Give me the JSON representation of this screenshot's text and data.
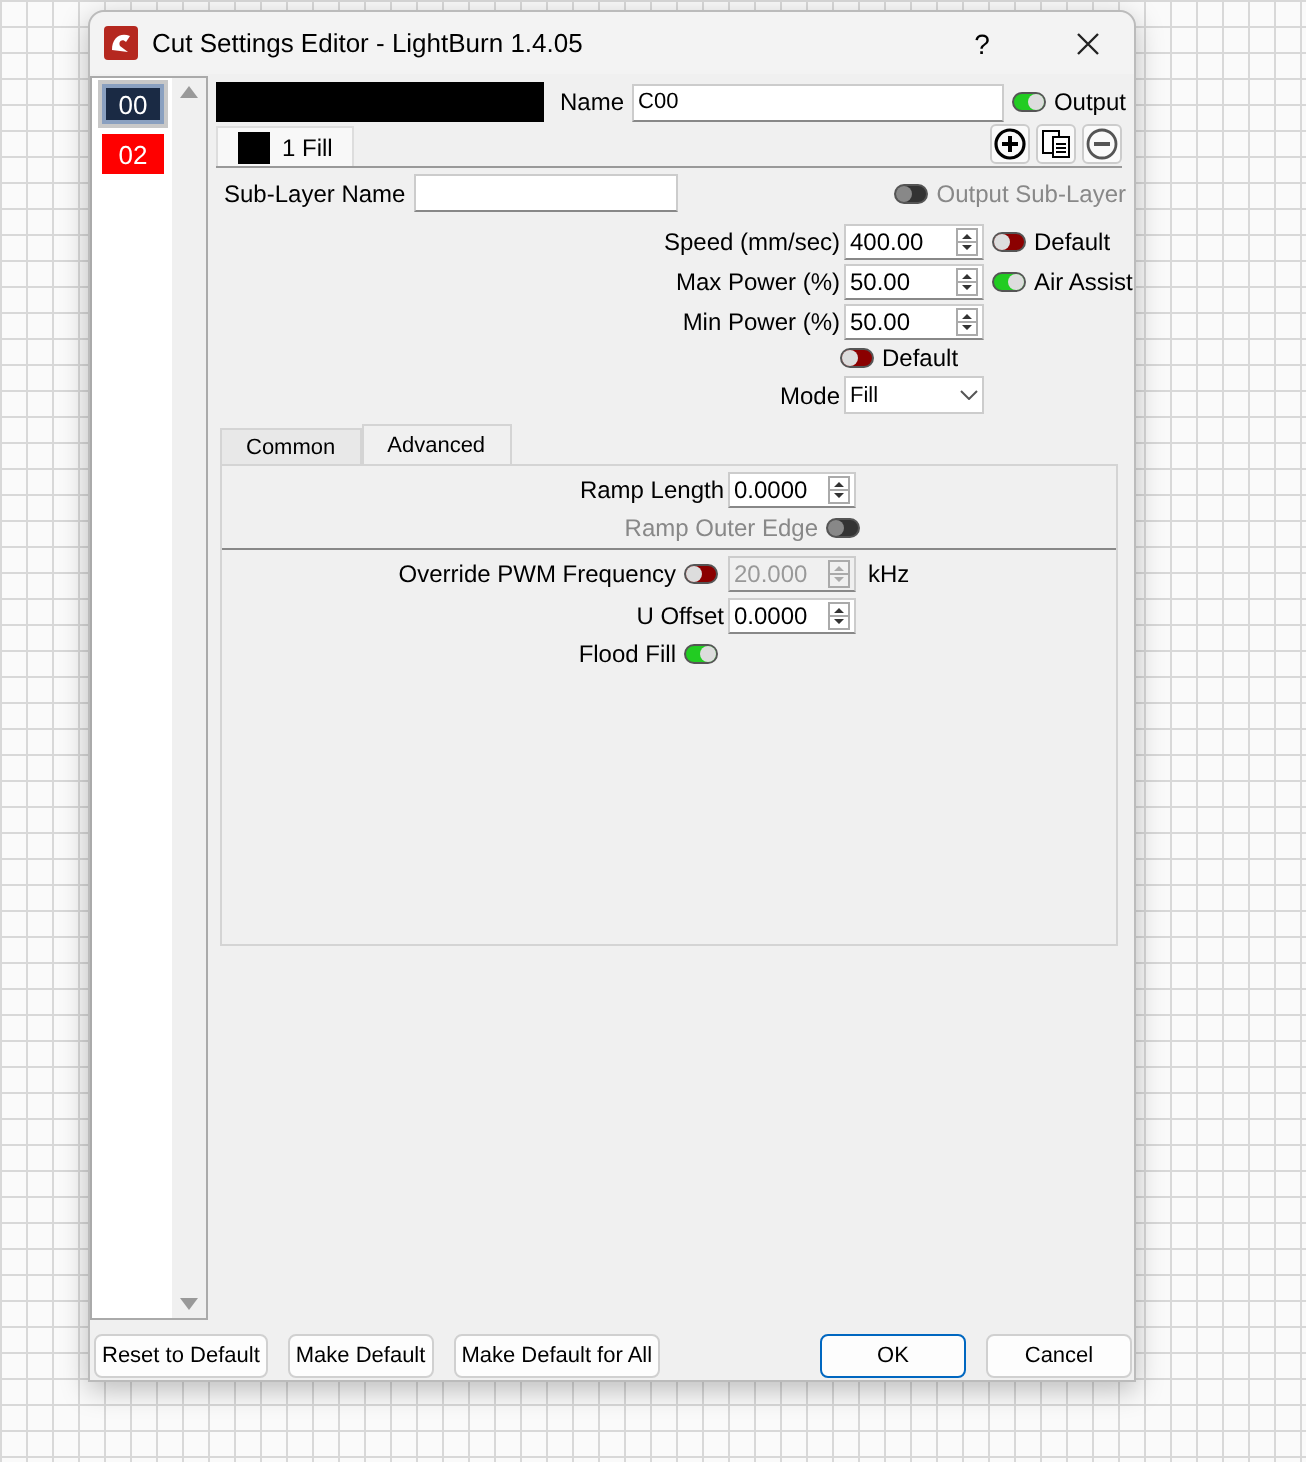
{
  "window": {
    "title": "Cut Settings Editor - LightBurn 1.4.05",
    "help": "?"
  },
  "layers": [
    {
      "label": "00",
      "color": "#1a2a44",
      "selected": true
    },
    {
      "label": "02",
      "color": "#ff0000",
      "selected": false
    }
  ],
  "layer_bar": {
    "color": "#000000"
  },
  "name": {
    "label": "Name",
    "value": "C00"
  },
  "output": {
    "label": "Output",
    "on": true
  },
  "sublayer_tabs": [
    {
      "label": "1 Fill",
      "color": "#000000",
      "selected": true
    }
  ],
  "sublayer_name": {
    "label": "Sub-Layer Name"
  },
  "output_sublayer": {
    "label": "Output Sub-Layer",
    "on": false,
    "disabled": true
  },
  "fields": [
    {
      "label": "Speed (mm/sec)",
      "value": "400.00",
      "toggle": {
        "label": "Default",
        "on": false
      }
    },
    {
      "label": "Max Power (%)",
      "value": "50.00",
      "toggle": {
        "label": "Air Assist",
        "on": true
      }
    },
    {
      "label": "Min Power (%)",
      "value": "50.00"
    }
  ],
  "default_toggle": {
    "label": "Default",
    "on": false
  },
  "mode": {
    "label": "Mode",
    "value": "Fill"
  },
  "tabs": [
    {
      "label": "Common",
      "selected": false
    },
    {
      "label": "Advanced",
      "selected": true
    }
  ],
  "advanced": [
    {
      "kind": "spin",
      "label": "Ramp Length",
      "value": "0.0000"
    },
    {
      "kind": "toggle_right",
      "label": "Ramp Outer Edge",
      "on": false,
      "disabled": true
    },
    {
      "kind": "divider"
    },
    {
      "kind": "pwm",
      "label": "Override PWM Frequency",
      "on": false,
      "value": "20.000",
      "unit": "kHz"
    },
    {
      "kind": "spin",
      "label": "U Offset",
      "value": "0.0000"
    },
    {
      "kind": "toggle",
      "label": "Flood Fill",
      "on": true,
      "disabled": false
    }
  ],
  "buttons_left": [
    "Reset to Default",
    "Make Default",
    "Make Default for All"
  ],
  "buttons_right": [
    {
      "label": "OK",
      "default": true
    },
    {
      "label": "Cancel",
      "default": false
    }
  ]
}
